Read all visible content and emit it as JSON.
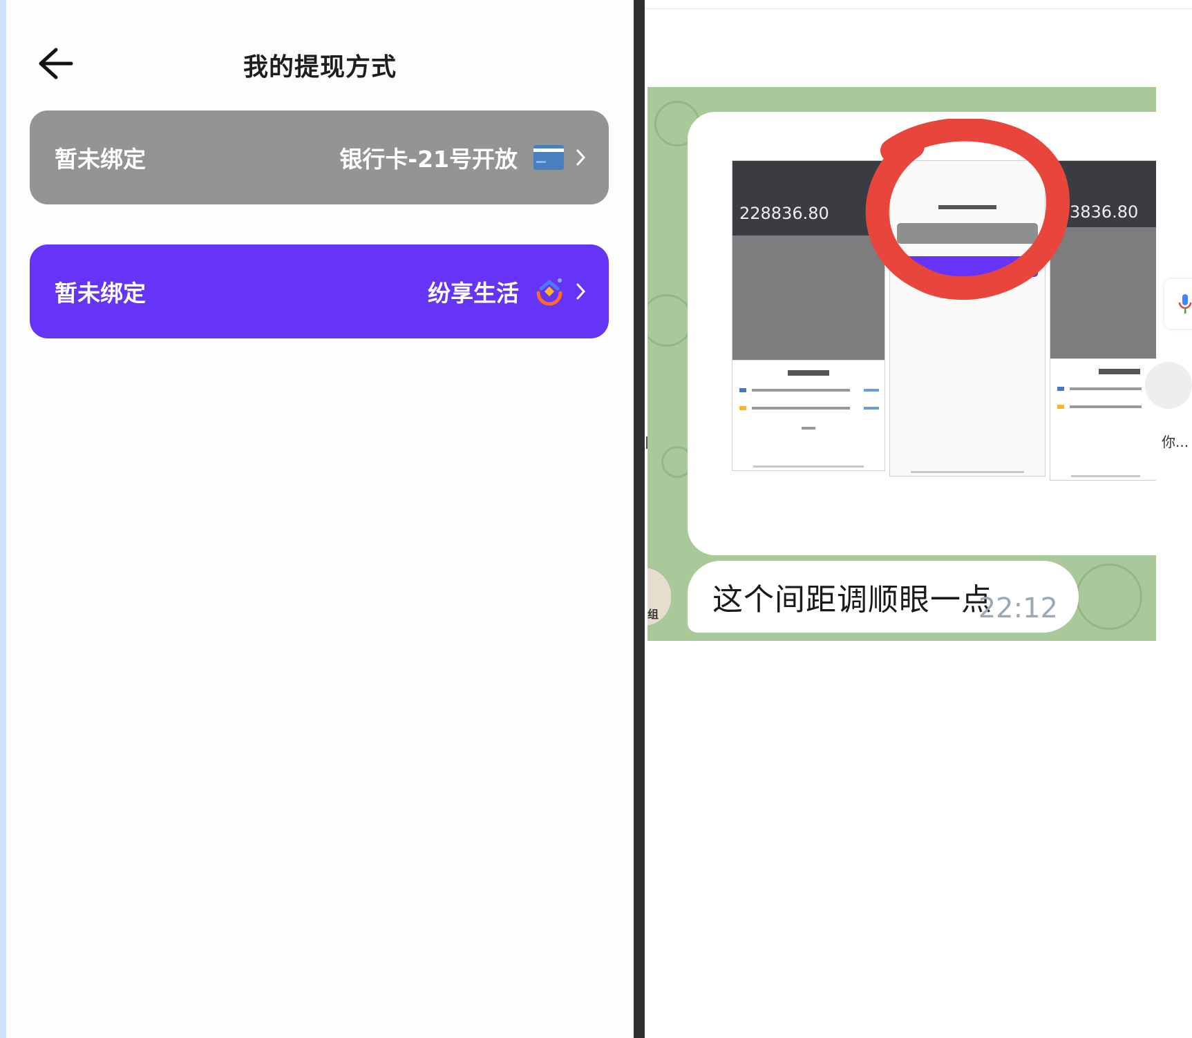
{
  "phone": {
    "title": "我的提现方式",
    "back_icon": "arrow-left-icon",
    "methods": [
      {
        "status": "暂未绑定",
        "name": "银行卡-21号开放",
        "icon": "bank-card-icon",
        "color": "#949495"
      },
      {
        "status": "暂未绑定",
        "name": "纷享生活",
        "icon": "fenxiang-logo-icon",
        "color": "#6534f6"
      }
    ]
  },
  "chat": {
    "image_message": {
      "amount_left": "228836.80",
      "amount_right": "3836.80",
      "annotation_color": "#e8463c"
    },
    "message": {
      "text": "这个间距调顺眼一点",
      "time": "22:12"
    },
    "side_preview": "你...",
    "mic_icon": "microphone-icon",
    "background_color": "#a9c99a"
  }
}
